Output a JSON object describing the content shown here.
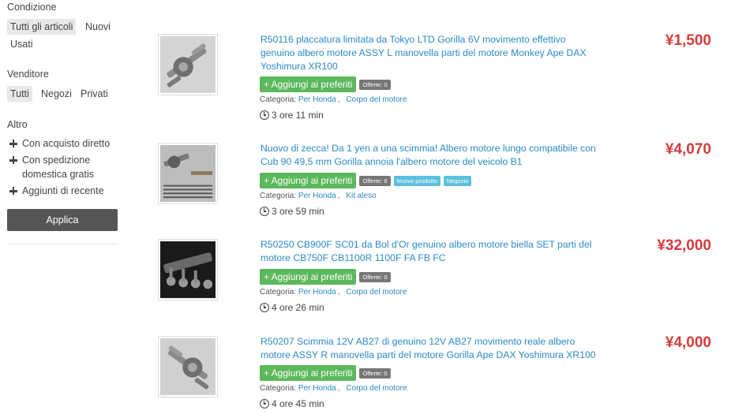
{
  "filters": {
    "condition": {
      "heading": "Condizione",
      "options": [
        "Tutti gli articoli",
        "Nuovi",
        "Usati"
      ],
      "selected": "Tutti gli articoli"
    },
    "seller": {
      "heading": "Venditore",
      "options": [
        "Tutti",
        "Negozi",
        "Privati"
      ],
      "selected": "Tutti"
    },
    "other": {
      "heading": "Altro",
      "options": [
        "Con acquisto diretto",
        "Con spedizione domestica gratis",
        "Aggiunti di recente"
      ]
    },
    "apply_label": "Applica"
  },
  "listings": [
    {
      "title": "R50116 placcatura limitata da Tokyo LTD Gorilla 6V movimento effettivo genuino albero motore ASSY L manovella parti del motore Monkey Ape DAX Yoshimura XR100",
      "price": "¥1,500",
      "fav_label": "+ Aggiungi ai preferiti",
      "badges": [
        {
          "text": "Offerte: 0",
          "color": "#777777"
        }
      ],
      "category_label": "Categoria:",
      "categories": [
        "Per Honda",
        "Corpo del motore"
      ],
      "time_left": "3 ore 11 min"
    },
    {
      "title": "Nuovo di zecca! Da 1 yen a una scimmia! Albero motore lungo compatibile con Cub 90 49,5 mm Gorilla annoia l'albero motore del veicolo B1",
      "price": "¥4,070",
      "fav_label": "+ Aggiungi ai preferiti",
      "badges": [
        {
          "text": "Offerte: 8",
          "color": "#777777"
        },
        {
          "text": "Nuovo prodotto",
          "color": "#5bc0de"
        },
        {
          "text": "Negozio",
          "color": "#5bc0de"
        }
      ],
      "category_label": "Categoria:",
      "categories": [
        "Per Honda",
        "Kit aleso"
      ],
      "time_left": "3 ore 59 min"
    },
    {
      "title": "R50250 CB900F SC01 da Bol d'Or genuino albero motore biella SET parti del motore CB750F CB1100R 1100F FA FB FC",
      "price": "¥32,000",
      "fav_label": "+ Aggiungi ai preferiti",
      "badges": [
        {
          "text": "Offerte: 0",
          "color": "#777777"
        }
      ],
      "category_label": "Categoria:",
      "categories": [
        "Per Honda",
        "Corpo del motore"
      ],
      "time_left": "4 ore 26 min"
    },
    {
      "title": "R50207 Scimmia 12V AB27 di genuino 12V AB27 movimento reale albero motore ASSY R manovella parti del motore Gorilla Ape DAX Yoshimura XR100",
      "price": "¥4,000",
      "fav_label": "+ Aggiungi ai preferiti",
      "badges": [
        {
          "text": "Offerte: 0",
          "color": "#777777"
        }
      ],
      "category_label": "Categoria:",
      "categories": [
        "Per Honda",
        "Corpo del motore"
      ],
      "time_left": "4 ore 45 min"
    }
  ]
}
